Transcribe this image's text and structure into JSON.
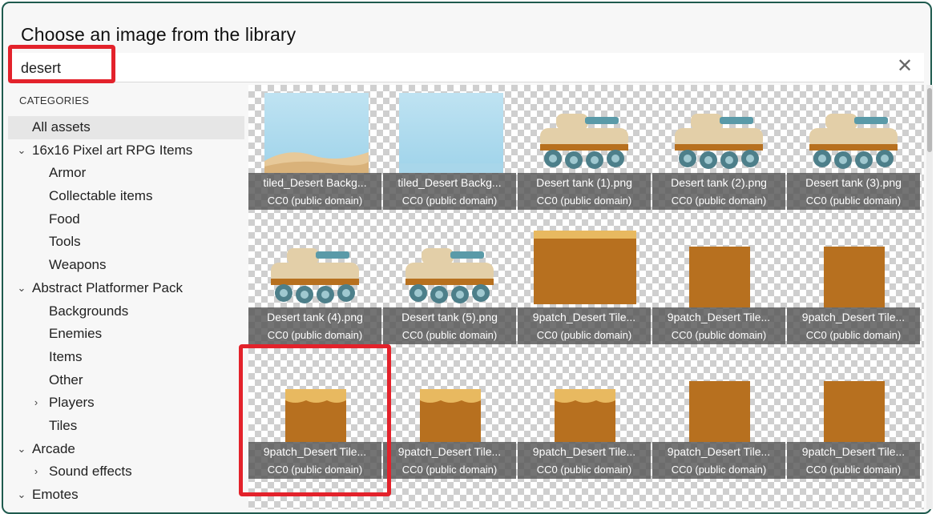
{
  "dialog": {
    "title": "Choose an image from the library"
  },
  "search": {
    "value": "desert",
    "clear_icon": "close-icon"
  },
  "sidebar": {
    "header": "CATEGORIES",
    "items": [
      {
        "label": "All assets",
        "level": 0,
        "chevron": "",
        "selected": true
      },
      {
        "label": "16x16 Pixel art RPG Items",
        "level": 0,
        "chevron": "expanded"
      },
      {
        "label": "Armor",
        "level": 1,
        "chevron": ""
      },
      {
        "label": "Collectable items",
        "level": 1,
        "chevron": ""
      },
      {
        "label": "Food",
        "level": 1,
        "chevron": ""
      },
      {
        "label": "Tools",
        "level": 1,
        "chevron": ""
      },
      {
        "label": "Weapons",
        "level": 1,
        "chevron": ""
      },
      {
        "label": "Abstract Platformer Pack",
        "level": 0,
        "chevron": "expanded"
      },
      {
        "label": "Backgrounds",
        "level": 1,
        "chevron": ""
      },
      {
        "label": "Enemies",
        "level": 1,
        "chevron": ""
      },
      {
        "label": "Items",
        "level": 1,
        "chevron": ""
      },
      {
        "label": "Other",
        "level": 1,
        "chevron": ""
      },
      {
        "label": "Players",
        "level": 1,
        "chevron": "collapsed"
      },
      {
        "label": "Tiles",
        "level": 1,
        "chevron": ""
      },
      {
        "label": "Arcade",
        "level": 0,
        "chevron": "expanded"
      },
      {
        "label": "Sound effects",
        "level": 1,
        "chevron": "collapsed"
      },
      {
        "label": "Emotes",
        "level": 0,
        "chevron": "expanded"
      }
    ]
  },
  "assets": [
    {
      "name": "tiled_Desert Backg...",
      "license": "CC0 (public domain)",
      "kind": "background"
    },
    {
      "name": "tiled_Desert Backg...",
      "license": "CC0 (public domain)",
      "kind": "background2"
    },
    {
      "name": "Desert tank (1).png",
      "license": "CC0 (public domain)",
      "kind": "tank"
    },
    {
      "name": "Desert tank (2).png",
      "license": "CC0 (public domain)",
      "kind": "tank"
    },
    {
      "name": "Desert tank (3).png",
      "license": "CC0 (public domain)",
      "kind": "tank"
    },
    {
      "name": "Desert tank (4).png",
      "license": "CC0 (public domain)",
      "kind": "tank-wheeled"
    },
    {
      "name": "Desert tank (5).png",
      "license": "CC0 (public domain)",
      "kind": "tank"
    },
    {
      "name": "9patch_Desert Tile...",
      "license": "CC0 (public domain)",
      "kind": "tile-large"
    },
    {
      "name": "9patch_Desert Tile...",
      "license": "CC0 (public domain)",
      "kind": "tile-plain"
    },
    {
      "name": "9patch_Desert Tile...",
      "license": "CC0 (public domain)",
      "kind": "tile-plain"
    },
    {
      "name": "9patch_Desert Tile...",
      "license": "CC0 (public domain)",
      "kind": "tile-top"
    },
    {
      "name": "9patch_Desert Tile...",
      "license": "CC0 (public domain)",
      "kind": "tile-top"
    },
    {
      "name": "9patch_Desert Tile...",
      "license": "CC0 (public domain)",
      "kind": "tile-top"
    },
    {
      "name": "9patch_Desert Tile...",
      "license": "CC0 (public domain)",
      "kind": "tile-plain"
    },
    {
      "name": "9patch_Desert Tile...",
      "license": "CC0 (public domain)",
      "kind": "tile-plain"
    }
  ],
  "colors": {
    "highlight": "#e3222b",
    "sand": "#b7701f",
    "sand_light": "#e8b960",
    "tank_body": "#e3cfa8",
    "tank_accent": "#5a9aa8"
  },
  "icons": {
    "chevron_expanded": "⌄",
    "chevron_collapsed": "›"
  }
}
